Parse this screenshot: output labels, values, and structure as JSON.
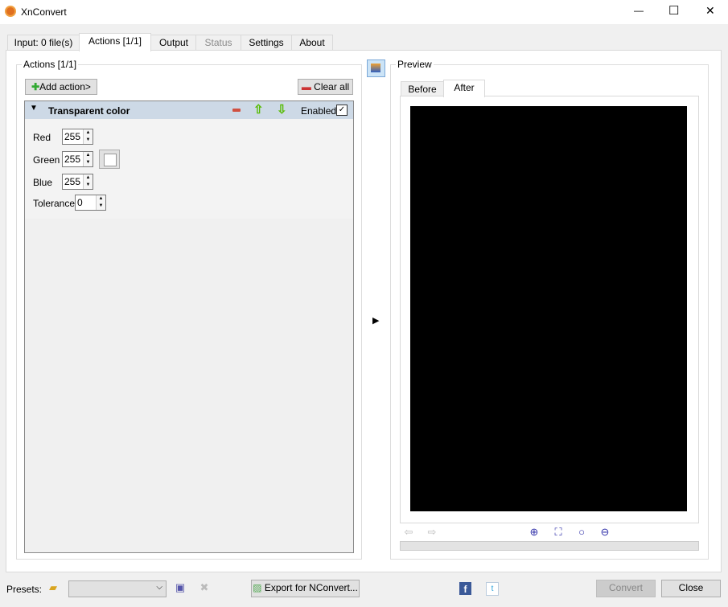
{
  "window": {
    "title": "XnConvert",
    "minimize": "—",
    "maximize": "☐",
    "close": "✕"
  },
  "tabs": [
    {
      "label": "Input: 0 file(s)"
    },
    {
      "label": "Actions [1/1]"
    },
    {
      "label": "Output"
    },
    {
      "label": "Status"
    },
    {
      "label": "Settings"
    },
    {
      "label": "About"
    }
  ],
  "actions": {
    "group_label": "Actions [1/1]",
    "add_action": "Add action>",
    "clear_all": "Clear all",
    "item": {
      "title": "Transparent color",
      "enabled_label": "Enabled",
      "enabled": true,
      "fields": [
        {
          "label": "Red",
          "value": "255"
        },
        {
          "label": "Green",
          "value": "255"
        },
        {
          "label": "Blue",
          "value": "255"
        },
        {
          "label": "Tolerance",
          "value": "0"
        }
      ],
      "swatch_color": "#ffffff"
    }
  },
  "preview": {
    "group_label": "Preview",
    "tabs": [
      "Before",
      "After"
    ],
    "active_tab": "After"
  },
  "bottom": {
    "presets_label": "Presets:",
    "preset_value": "",
    "export": "Export for NConvert...",
    "convert": "Convert",
    "close": "Close"
  }
}
